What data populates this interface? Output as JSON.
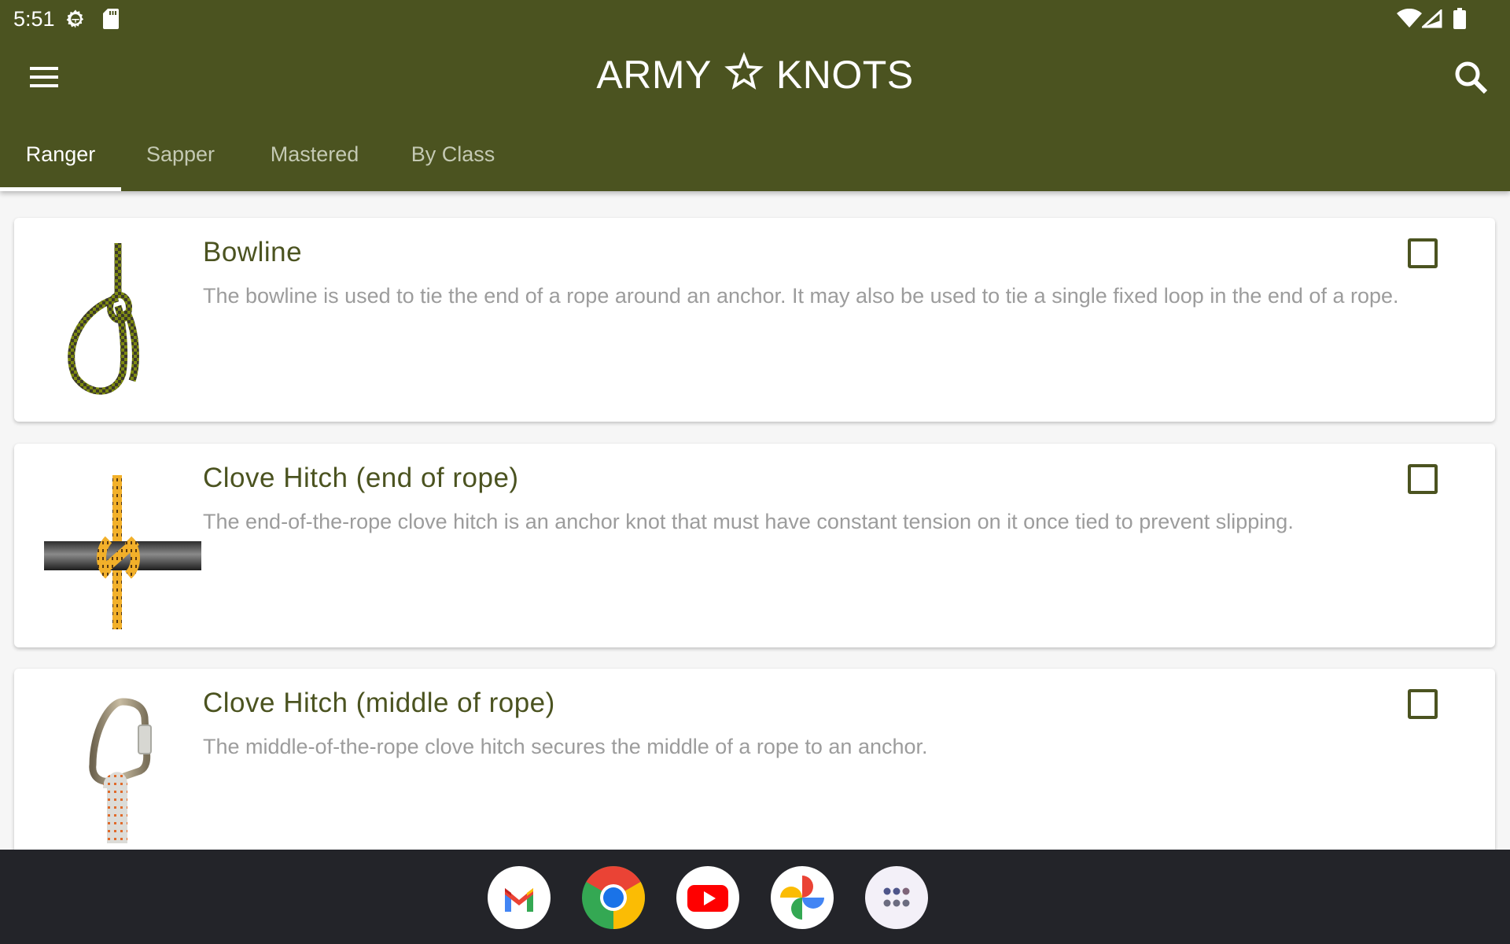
{
  "status_bar": {
    "time": "5:51",
    "icons": [
      "settings-gear-icon",
      "sd-card-icon",
      "wifi-icon",
      "signal-icon",
      "battery-icon"
    ]
  },
  "toolbar": {
    "title_left": "ARMY",
    "title_right": "KNOTS",
    "menu_icon": "hamburger-menu-icon",
    "search_icon": "search-icon",
    "brand_color": "#4b5320"
  },
  "tabs": [
    {
      "label": "Ranger",
      "active": true
    },
    {
      "label": "Sapper",
      "active": false
    },
    {
      "label": "Mastered",
      "active": false
    },
    {
      "label": "By Class",
      "active": false
    }
  ],
  "knots": [
    {
      "name": "Bowline",
      "description": "The bowline is used to tie the end of a rope around an anchor. It may also be used to tie a single fixed loop in the end of a rope.",
      "checked": false,
      "image": "bowline-knot-image"
    },
    {
      "name": "Clove Hitch (end of rope)",
      "description": "The end-of-the-rope clove hitch is an anchor knot that must have constant tension on it once tied to prevent slipping.",
      "checked": false,
      "image": "clove-hitch-end-image"
    },
    {
      "name": "Clove Hitch (middle of rope)",
      "description": "The middle-of-the-rope clove hitch secures the middle of a rope to an anchor.",
      "checked": false,
      "image": "clove-hitch-middle-image"
    }
  ],
  "dock": [
    {
      "name": "Gmail"
    },
    {
      "name": "Chrome"
    },
    {
      "name": "YouTube"
    },
    {
      "name": "Photos"
    },
    {
      "name": "App drawer"
    }
  ]
}
